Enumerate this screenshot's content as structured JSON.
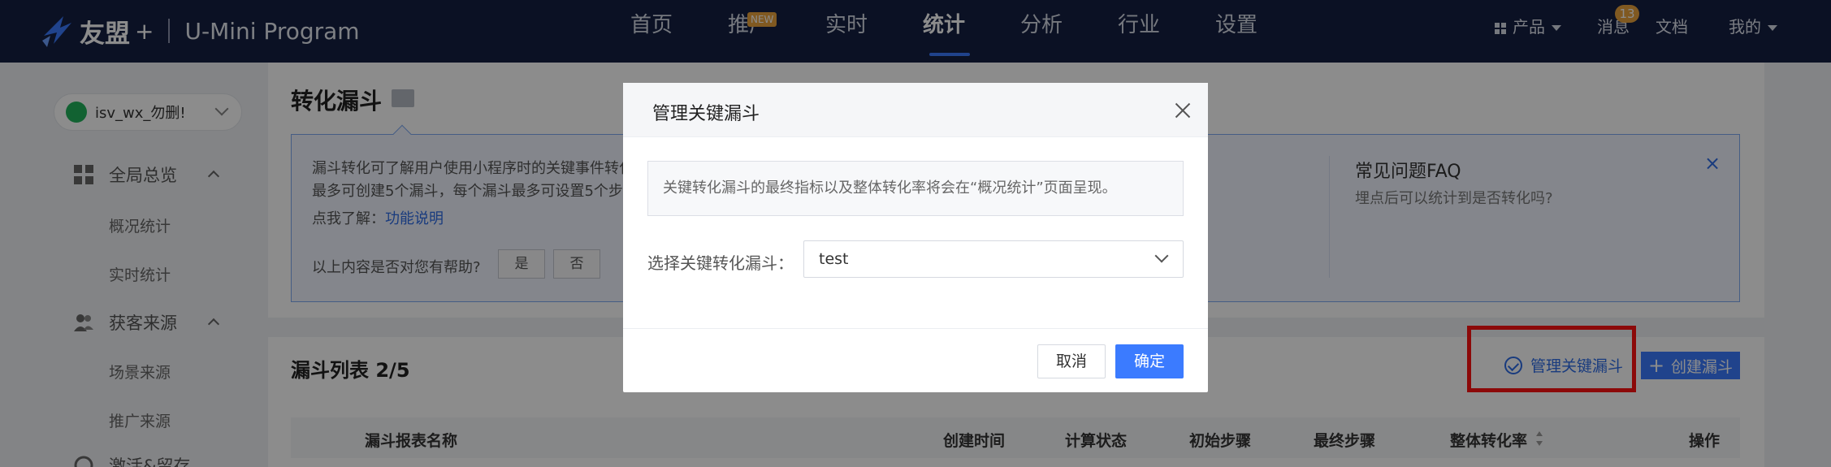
{
  "topnav": {
    "brand": "友盟",
    "plus": "+",
    "product": "U-Mini Program",
    "menu": [
      "首页",
      "推广",
      "实时",
      "统计",
      "分析",
      "行业",
      "设置"
    ],
    "active_menu": "统计",
    "new_badge": "NEW",
    "right": {
      "products": "产品",
      "messages": "消息",
      "messages_count": "13",
      "docs": "文档",
      "mine": "我的"
    },
    "colors": {
      "bg": "#142043",
      "accent": "#3b7bff",
      "badge": "#e9a33d"
    }
  },
  "sidebar": {
    "app_name": "isv_wx_勿删!",
    "groups": [
      {
        "label": "全局总览",
        "icon": "grid-icon",
        "items": [
          "概况统计",
          "实时统计"
        ]
      },
      {
        "label": "获客来源",
        "icon": "users-icon",
        "items": [
          "场景来源",
          "推广来源"
        ]
      },
      {
        "label": "激活&留存",
        "icon": "chart-icon",
        "items": []
      }
    ]
  },
  "main": {
    "title": "转化漏斗",
    "intro": {
      "line1": "漏斗转化可了解用户使用小程序时的关键事件转化",
      "line2": "最多可创建5个漏斗，每个漏斗最多可设置5个步骤",
      "learn_prefix": "点我了解：",
      "learn_link": "功能说明",
      "helpful_question": "以上内容是否对您有帮助?",
      "yes": "是",
      "no": "否"
    },
    "faq": {
      "title": "常见问题FAQ",
      "question": "埋点后可以统计到是否转化吗?",
      "close": "×"
    },
    "list": {
      "title": "漏斗列表 2/5",
      "manage_label": "管理关键漏斗",
      "create_label": "创建漏斗",
      "columns": [
        "漏斗报表名称",
        "创建时间",
        "计算状态",
        "初始步骤",
        "最终步骤",
        "整体转化率",
        "操作"
      ]
    }
  },
  "dialog": {
    "title": "管理关键漏斗",
    "notice": "关键转化漏斗的最终指标以及整体转化率将会在“概况统计”页面呈现。",
    "select_label": "选择关键转化漏斗：",
    "select_value": "test",
    "cancel": "取消",
    "confirm": "确定"
  }
}
